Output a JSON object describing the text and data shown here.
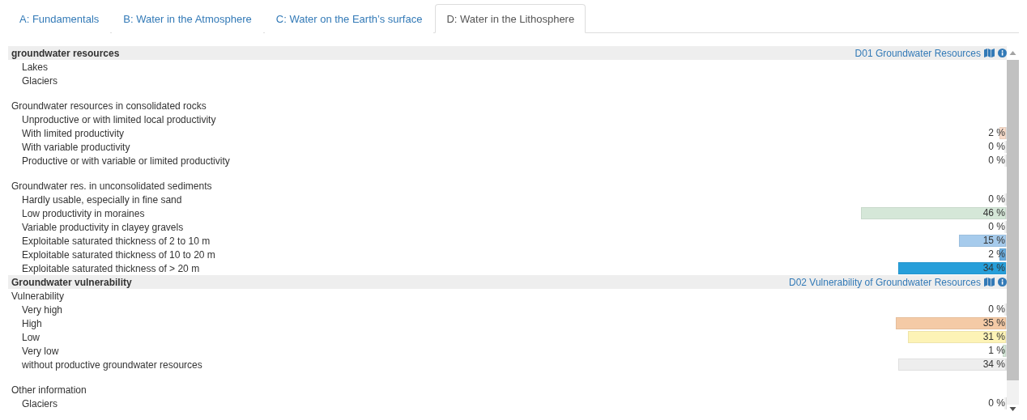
{
  "tabs": [
    {
      "label": "A: Fundamentals",
      "selected": false
    },
    {
      "label": "B: Water in the Atmosphere",
      "selected": false
    },
    {
      "label": "C: Water on the Earth’s surface",
      "selected": false
    },
    {
      "label": "D: Water in the Lithosphere",
      "selected": true
    }
  ],
  "sections": [
    {
      "title": "groundwater resources",
      "link": "D01 Groundwater Resources",
      "groups": [
        {
          "items": [
            {
              "label": "Lakes"
            },
            {
              "label": "Glaciers"
            }
          ]
        },
        {
          "label": "Groundwater resources in consolidated rocks",
          "items": [
            {
              "label": "Unproductive or with limited local productivity"
            },
            {
              "label": "With limited productivity",
              "value": "2 %",
              "level": 0.02,
              "color": "#f8dccb"
            },
            {
              "label": "With variable productivity",
              "value": "0 %",
              "level": 0
            },
            {
              "label": "Productive or with variable or limited productivity",
              "value": "0 %",
              "level": 0
            }
          ]
        },
        {
          "label": "Groundwater res. in unconsolidated sediments",
          "items": [
            {
              "label": "Hardly usable, especially in fine sand",
              "value": "0 %",
              "level": 0
            },
            {
              "label": "Low productivity in moraines",
              "value": "46 %",
              "level": 0.46,
              "color": "#d5e7d8"
            },
            {
              "label": "Variable productivity in clayey gravels",
              "value": "0 %",
              "level": 0
            },
            {
              "label": "Exploitable saturated thickness of 2 to 10 m",
              "value": "15 %",
              "level": 0.15,
              "color": "#a6cbec"
            },
            {
              "label": "Exploitable saturated thickness of 10 to 20 m",
              "value": "2 %",
              "level": 0.02,
              "color": "#6badde"
            },
            {
              "label": "Exploitable saturated thickness of > 20 m",
              "value": "34 %",
              "level": 0.34,
              "color": "#279fda"
            }
          ]
        }
      ]
    },
    {
      "title": "Groundwater vulnerability",
      "link": "D02 Vulnerability of Groundwater Resources",
      "groups": [
        {
          "label": "Vulnerability",
          "items": [
            {
              "label": "Very high",
              "value": "0 %",
              "level": 0
            },
            {
              "label": "High",
              "value": "35 %",
              "level": 0.35,
              "color": "#f4caa6"
            },
            {
              "label": "Low",
              "value": "31 %",
              "level": 0.31,
              "color": "#fdf3b6"
            },
            {
              "label": "Very low",
              "value": "1 %",
              "level": 0.01,
              "color": "#d5e7d8"
            },
            {
              "label": "without productive groundwater resources",
              "value": "34 %",
              "level": 0.34,
              "color": "#eeeeee"
            }
          ]
        },
        {
          "label": "Other information",
          "items": [
            {
              "label": "Glaciers",
              "value": "0 %",
              "level": 0
            }
          ]
        }
      ]
    }
  ]
}
